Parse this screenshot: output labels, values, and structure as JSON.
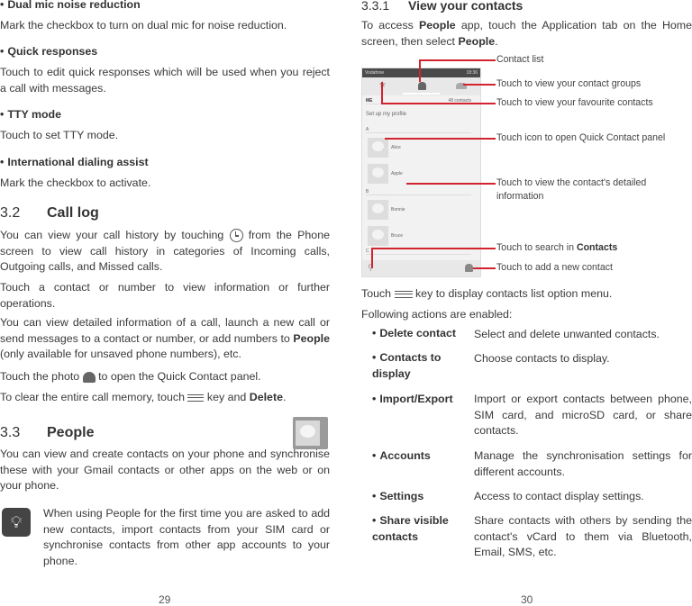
{
  "left": {
    "items": [
      {
        "title": "Dual mic noise reduction",
        "text": "Mark the checkbox to turn on dual mic for noise reduction."
      },
      {
        "title": "Quick responses",
        "text": "Touch to edit quick responses which will be used when you reject a call with messages."
      },
      {
        "title": "TTY mode",
        "text": "Touch to set TTY mode."
      },
      {
        "title": "International dialing assist",
        "text": "Mark the checkbox to activate."
      }
    ],
    "calllog": {
      "num": "3.2",
      "title": "Call log",
      "p1a": "You can view your call history by touching",
      "p1b": "from the Phone screen to view call history in categories of Incoming calls, Outgoing calls, and Missed calls.",
      "p2": "Touch a contact or number to view information or further operations.",
      "p3a": "You can view detailed information of a call, launch a new call or send messages to a contact or number, or add numbers to",
      "p3b": "People",
      "p3c": "(only available for unsaved phone numbers), etc.",
      "p4a": "Touch the photo",
      "p4b": "to open the Quick Contact panel.",
      "p5a": "To clear the entire call memory, touch",
      "p5b": "key and",
      "p5c": "Delete",
      "p5d": "."
    },
    "people": {
      "num": "3.3",
      "title": "People",
      "p1": "You can view and create contacts on your phone and synchronise these with your Gmail contacts or other apps on the web or on your phone.",
      "tip": "When using People for the first time you are asked to add new contacts, import contacts from your SIM card or synchronise contacts from other app accounts to your phone."
    },
    "page": "29"
  },
  "right": {
    "num": "3.3.1",
    "title": "View your contacts",
    "p1a": "To access",
    "p1b": "People",
    "p1c": "app, touch the Application tab on the Home screen, then select",
    "p1d": "People",
    "p1e": ".",
    "phone": {
      "carrier": "Vodafone",
      "time": "18:36",
      "me": "ME",
      "count": "48 contacts",
      "setup": "Set up my profile",
      "letters": [
        "A",
        "B",
        "C"
      ],
      "contacts": [
        "Alice",
        "Apple",
        "Bonnie",
        "Bruce"
      ]
    },
    "labels": {
      "contact_list": "Contact list",
      "groups": "Touch to view your contact groups",
      "favourites": "Touch to view your favourite contacts",
      "quick": "Touch icon to open Quick Contact panel",
      "detail": "Touch to view the contact's detailed information",
      "search_a": "Touch to search in",
      "search_b": "Contacts",
      "add": "Touch to add a new contact"
    },
    "menu_a": "Touch",
    "menu_b": "key to display contacts list option menu.",
    "following": "Following actions are enabled:",
    "actions": [
      {
        "key": "Delete contact",
        "desc": "Select and delete unwanted contacts."
      },
      {
        "key": "Contacts to display",
        "desc": "Choose contacts to display."
      },
      {
        "key": "Import/Export",
        "desc": "Import or export contacts between phone, SIM card, and microSD card, or share contacts."
      },
      {
        "key": "Accounts",
        "desc": "Manage the synchronisation settings for different accounts."
      },
      {
        "key": "Settings",
        "desc": "Access to contact display settings."
      },
      {
        "key": "Share visible contacts",
        "desc": "Share contacts with others by sending the contact's vCard to them via Bluetooth, Email, SMS, etc."
      }
    ],
    "page": "30"
  },
  "colors": {
    "callout": "#d2232f",
    "text": "#3a3a3a"
  }
}
